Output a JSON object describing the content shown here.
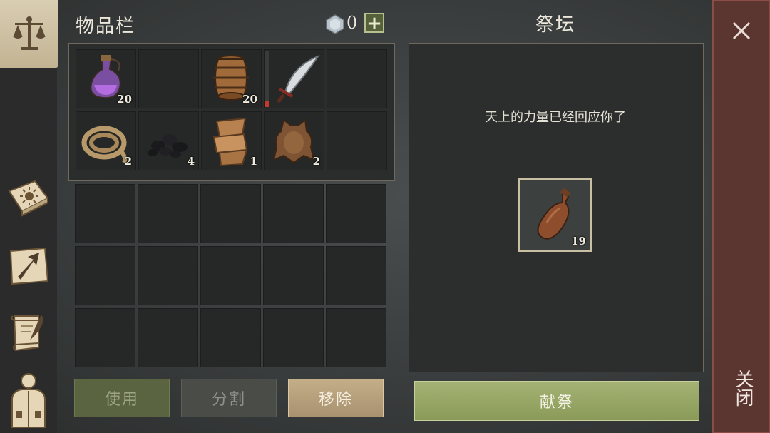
{
  "inventory": {
    "title": "物品栏",
    "currency_value": "0",
    "currency_icon": "gem-icon",
    "add_currency_label": "+",
    "slots": [
      {
        "icon": "potion-icon",
        "qty": "20"
      },
      {
        "icon": "",
        "qty": ""
      },
      {
        "icon": "barrel-icon",
        "qty": "20"
      },
      {
        "icon": "scimitar-icon",
        "qty": ""
      },
      {
        "icon": "",
        "qty": ""
      },
      {
        "icon": "rope-icon",
        "qty": "2"
      },
      {
        "icon": "coal-icon",
        "qty": "4"
      },
      {
        "icon": "cloth-icon",
        "qty": "1"
      },
      {
        "icon": "hide-icon",
        "qty": "2"
      },
      {
        "icon": "",
        "qty": ""
      }
    ],
    "use_label": "使用",
    "split_label": "分割",
    "remove_label": "移除"
  },
  "altar": {
    "title": "祭坛",
    "message": "天上的力量已经回应你了",
    "offered_item": {
      "icon": "bottle-icon",
      "qty": "19"
    },
    "offer_label": "献祭"
  },
  "close_label": "关闭",
  "sidebar": {
    "items": [
      {
        "icon": "scales-icon",
        "active": true
      },
      {
        "icon": "sun-book-icon",
        "active": false
      },
      {
        "icon": "arrow-map-icon",
        "active": false
      },
      {
        "icon": "scroll-quill-icon",
        "active": false
      },
      {
        "icon": "character-icon",
        "active": false
      }
    ]
  },
  "colors": {
    "accent_green": "#97a663",
    "close_red": "#5b3631",
    "slot_bg": "#252827"
  }
}
